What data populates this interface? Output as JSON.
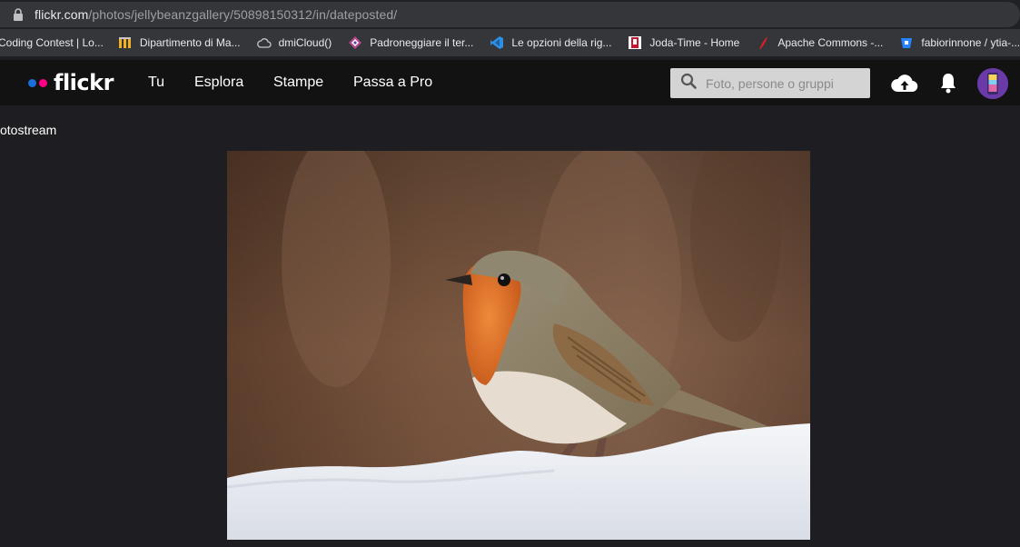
{
  "browser": {
    "url_domain": "flickr.com",
    "url_path": "/photos/jellybeanzgallery/50898150312/in/dateposted/"
  },
  "bookmarks": [
    {
      "label": "Coding Contest | Lo...",
      "icon": "contest-icon"
    },
    {
      "label": "Dipartimento di Ma...",
      "icon": "university-icon"
    },
    {
      "label": "dmiCloud()",
      "icon": "cloud-icon"
    },
    {
      "label": "Padroneggiare il ter...",
      "icon": "terminal-icon"
    },
    {
      "label": "Le opzioni della rig...",
      "icon": "vscode-icon"
    },
    {
      "label": "Joda-Time - Home",
      "icon": "joda-icon"
    },
    {
      "label": "Apache Commons -...",
      "icon": "apache-feather-icon"
    },
    {
      "label": "fabiorinnone / ytia-...",
      "icon": "bitbucket-icon"
    }
  ],
  "header": {
    "logo_text": "flickr",
    "nav": [
      "Tu",
      "Esplora",
      "Stampe",
      "Passa a Pro"
    ],
    "search_placeholder": "Foto, persone o gruppi"
  },
  "content": {
    "back_link": "otostream"
  },
  "colors": {
    "flickr_blue": "#1b6fd9",
    "flickr_pink": "#ff0084",
    "header_bg": "#121212",
    "page_bg": "#1e1e22"
  }
}
